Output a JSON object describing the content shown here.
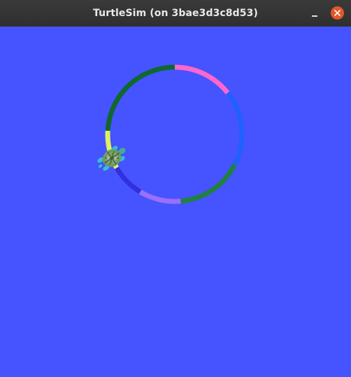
{
  "window": {
    "title": "TurtleSim (on 3bae3d3c8d53)",
    "background_color": "#4554fe"
  },
  "controls": {
    "minimize_icon": "minimize-icon",
    "close_icon": "close-icon"
  },
  "trail_segments": [
    {
      "color": "#ff66cc"
    },
    {
      "color": "#2060ff"
    },
    {
      "color": "#228040"
    },
    {
      "color": "#9a70ff"
    },
    {
      "color": "#3030e0"
    },
    {
      "color": "#e0f060"
    },
    {
      "color": "#106830"
    }
  ],
  "turtle": {
    "icon": "turtle-icon"
  }
}
